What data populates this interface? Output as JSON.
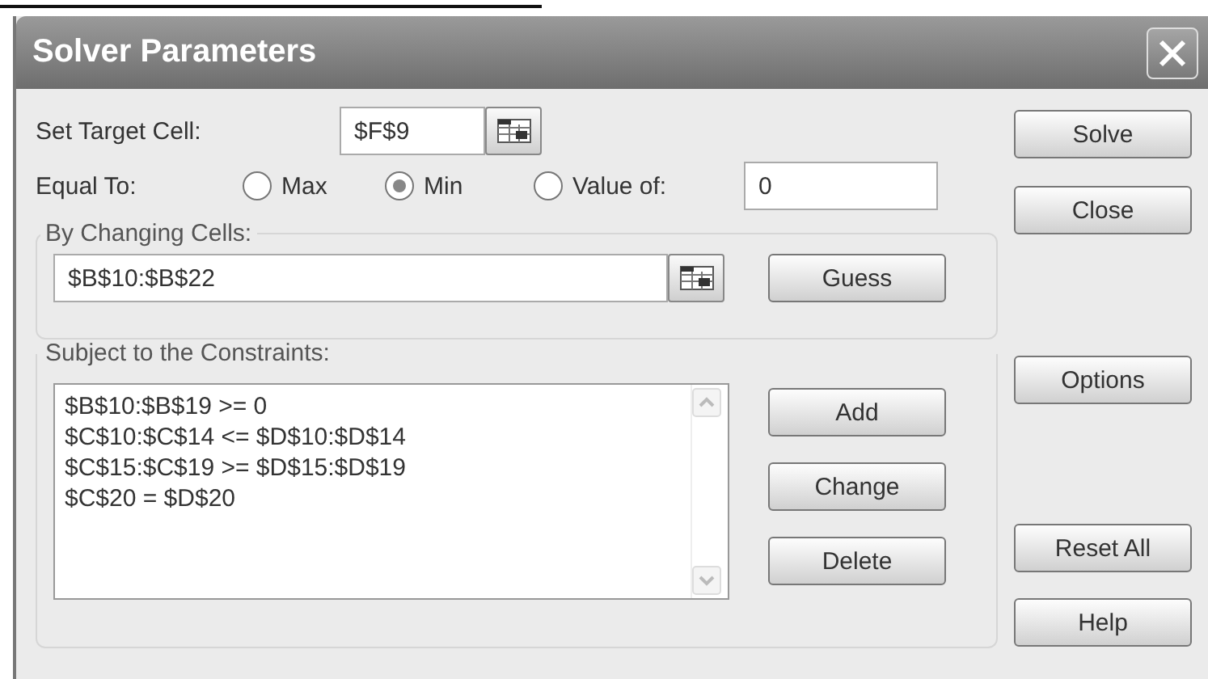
{
  "window": {
    "title": "Solver Parameters"
  },
  "target_cell": {
    "label": "Set Target Cell:",
    "value": "$F$9"
  },
  "equal_to": {
    "label": "Equal To:",
    "options": [
      {
        "label": "Max",
        "selected": false
      },
      {
        "label": "Min",
        "selected": true
      },
      {
        "label": "Value of:",
        "selected": false
      }
    ],
    "value_of": "0"
  },
  "changing_cells": {
    "label": "By Changing Cells:",
    "value": "$B$10:$B$22",
    "button": {
      "label": "Guess"
    }
  },
  "constraints": {
    "label": "Subject to the Constraints:",
    "items": [
      "$B$10:$B$19 >= 0",
      "$C$10:$C$14 <= $D$10:$D$14",
      "$C$15:$C$19 >= $D$15:$D$19",
      "$C$20 = $D$20"
    ],
    "buttons": [
      {
        "label": "Add"
      },
      {
        "label": "Change"
      },
      {
        "label": "Delete"
      }
    ]
  },
  "side_buttons": [
    {
      "label": "Solve"
    },
    {
      "label": "Close"
    },
    {
      "label": "Options"
    },
    {
      "label": "Reset All"
    },
    {
      "label": "Help"
    }
  ]
}
